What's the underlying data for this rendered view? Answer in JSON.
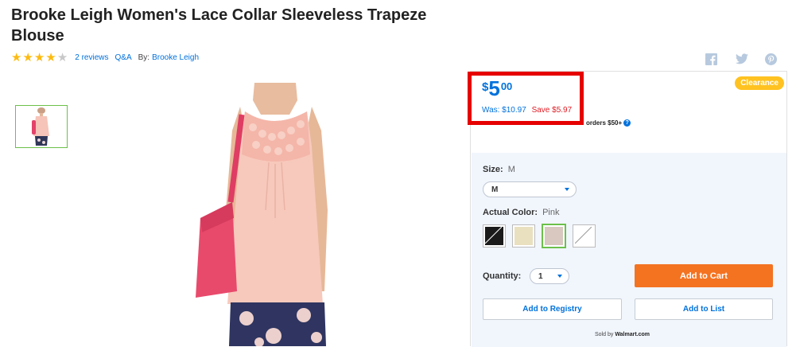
{
  "product": {
    "title": "Brooke Leigh Women's Lace Collar Sleeveless Trapeze Blouse",
    "rating": 4,
    "rating_max": 5,
    "reviews_label": "2 reviews",
    "qa_label": "Q&A",
    "by_label": "By:",
    "brand": "Brooke Leigh"
  },
  "social": {
    "icons": [
      "facebook-icon",
      "twitter-icon",
      "pinterest-icon"
    ],
    "color": "#b7c9de"
  },
  "price": {
    "currency": "$",
    "dollars": "5",
    "cents": "00",
    "was": "Was: $10.97",
    "save": "Save $5.97",
    "badge": "Clearance",
    "shipping_note": "orders $50+"
  },
  "options": {
    "size_label": "Size:",
    "size_value": "M",
    "size_select": "M",
    "color_label": "Actual Color:",
    "color_value": "Pink",
    "swatches": [
      {
        "name": "black",
        "color": "#1a1a1a"
      },
      {
        "name": "cream",
        "color": "#e9e0c0"
      },
      {
        "name": "pink",
        "color": "#d8c8bf",
        "selected": true
      },
      {
        "name": "white",
        "color": "#ffffff"
      }
    ],
    "quantity_label": "Quantity:",
    "quantity_value": "1"
  },
  "actions": {
    "add_to_cart": "Add to Cart",
    "add_to_registry": "Add to Registry",
    "add_to_list": "Add to List"
  },
  "seller": {
    "prefix": "Sold by",
    "name": "Walmart.com"
  },
  "colors": {
    "accent": "#0071dc",
    "cart": "#f47321",
    "clearance": "#ffc220",
    "star": "#fdbb11",
    "save": "#de1c24",
    "highlight": "#e60000"
  }
}
